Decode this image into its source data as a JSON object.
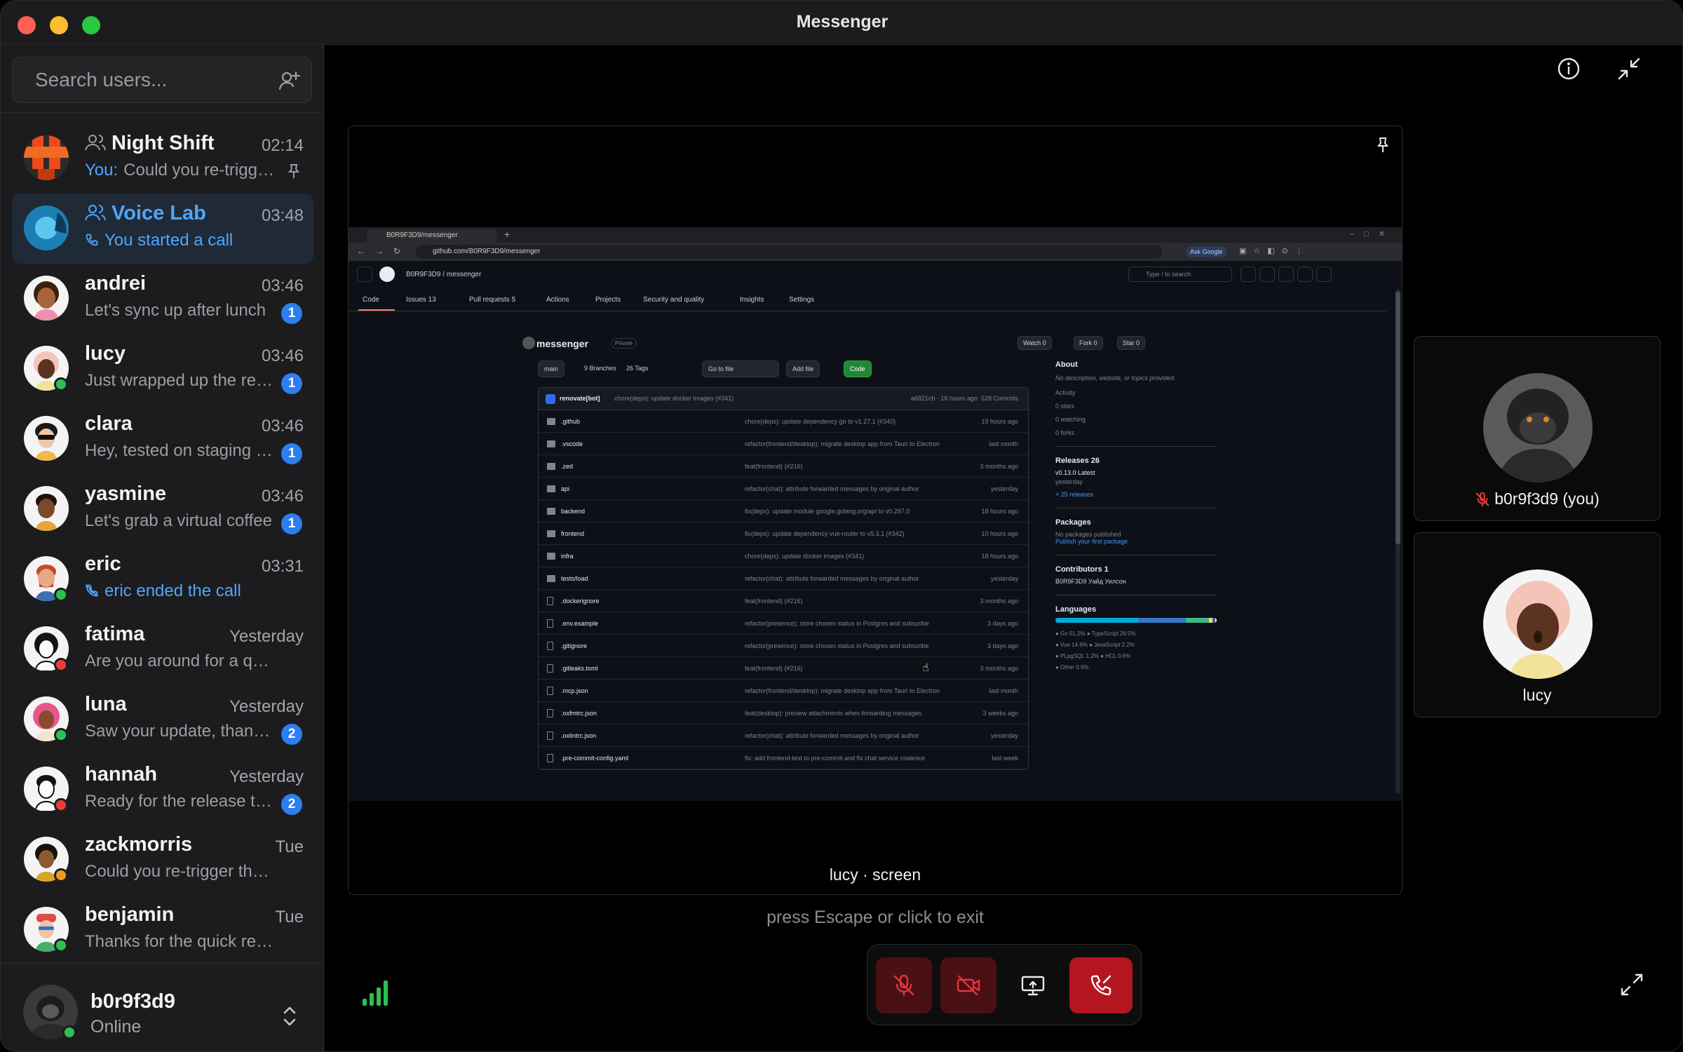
{
  "app": {
    "title": "Messenger"
  },
  "search": {
    "placeholder": "Search users..."
  },
  "conversations": [
    {
      "name": "Night Shift",
      "time": "02:14",
      "you": "You:",
      "preview": "Could you re-trigger the pipeline?",
      "group": true,
      "pinned": true,
      "status": null
    },
    {
      "name": "Voice Lab",
      "time": "03:48",
      "preview": "You started a call",
      "group": true,
      "call": true,
      "active": true,
      "status": null
    },
    {
      "name": "andrei",
      "time": "03:46",
      "preview": "Let's sync up after lunch",
      "badge": "1",
      "status": null
    },
    {
      "name": "lucy",
      "time": "03:46",
      "preview": "Just wrapped up the review",
      "badge": "1",
      "status": "online"
    },
    {
      "name": "clara",
      "time": "03:46",
      "preview": "Hey, tested on staging today",
      "badge": "1",
      "status": null
    },
    {
      "name": "yasmine",
      "time": "03:46",
      "preview": "Let's grab a virtual coffee",
      "badge": "1",
      "status": null
    },
    {
      "name": "eric",
      "time": "03:31",
      "preview": "eric ended the call",
      "call": true,
      "status": "online"
    },
    {
      "name": "fatima",
      "time": "Yesterday",
      "preview": "Are you around for a quick chat?",
      "status": "busy"
    },
    {
      "name": "luna",
      "time": "Yesterday",
      "preview": "Saw your update, thanks!",
      "badge": "2",
      "status": "online"
    },
    {
      "name": "hannah",
      "time": "Yesterday",
      "preview": "Ready for the release tomorrow?",
      "badge": "2",
      "status": "busy"
    },
    {
      "name": "zackmorris",
      "time": "Tue",
      "preview": "Could you re-trigger the build?",
      "status": "away"
    },
    {
      "name": "benjamin",
      "time": "Tue",
      "preview": "Thanks for the quick review!",
      "status": "online"
    }
  ],
  "self": {
    "name": "b0r9f3d9",
    "status": "Online"
  },
  "stage": {
    "label": "lucy · screen",
    "hint": "press Escape or click to exit"
  },
  "participants": [
    {
      "label": "b0r9f3d9 (you)",
      "muted": true
    },
    {
      "label": "lucy",
      "muted": false
    }
  ],
  "browser": {
    "tab_title": "B0R9F3D9/messenger",
    "url": "github.com/B0R9F3D9/messenger",
    "ask": "Ask Google"
  },
  "github": {
    "owner": "B0R9F3D9  /  messenger",
    "search": "Type / to search",
    "tabs": [
      "Code",
      "Issues 13",
      "Pull requests 5",
      "Actions",
      "Projects",
      "Security and quality",
      "Insights",
      "Settings"
    ],
    "repo": "messenger",
    "visibility": "Private",
    "watch": "Watch 0",
    "fork": "Fork 0",
    "star": "Star 0",
    "branch": "main",
    "branches": "9 Branches",
    "tags": "26 Tags",
    "goto": "Go to file",
    "add_file": "Add file",
    "code": "Code",
    "commit": {
      "author": "renovate[bot]",
      "message": "chore(deps): update docker images (#341)",
      "meta": "a6821cb · 18 hours ago",
      "commits": "528 Commits"
    },
    "files": [
      {
        "name": ".github",
        "dir": true,
        "msg": "chore(deps): update dependency go to v1.27.1 (#340)",
        "date": "19 hours ago"
      },
      {
        "name": ".vscode",
        "dir": true,
        "msg": "refactor(frontend/desktop): migrate desktop app from Tauri to Electron",
        "date": "last month"
      },
      {
        "name": ".zed",
        "dir": true,
        "msg": "feat(frontend) (#216)",
        "date": "3 months ago"
      },
      {
        "name": "api",
        "dir": true,
        "msg": "refactor(chat): attribute forwarded messages by original author",
        "date": "yesterday"
      },
      {
        "name": "backend",
        "dir": true,
        "msg": "fix(deps): update module google.golang.org/api to v0.297.0",
        "date": "18 hours ago"
      },
      {
        "name": "frontend",
        "dir": true,
        "msg": "fix(deps): update dependency vue-router to v5.3.1 (#342)",
        "date": "10 hours ago"
      },
      {
        "name": "infra",
        "dir": true,
        "msg": "chore(deps): update docker images (#341)",
        "date": "18 hours ago"
      },
      {
        "name": "tests/load",
        "dir": true,
        "msg": "refactor(chat): attribute forwarded messages by original author",
        "date": "yesterday"
      },
      {
        "name": ".dockerignore",
        "dir": false,
        "msg": "feat(frontend) (#216)",
        "date": "3 months ago"
      },
      {
        "name": ".env.example",
        "dir": false,
        "msg": "refactor(presence): store chosen status in Postgres and subscribe",
        "date": "3 days ago"
      },
      {
        "name": ".gitignore",
        "dir": false,
        "msg": "refactor(presence): store chosen status in Postgres and subscribe",
        "date": "3 days ago"
      },
      {
        "name": ".gitleaks.toml",
        "dir": false,
        "msg": "feat(frontend) (#216)",
        "date": "3 months ago"
      },
      {
        "name": ".mcp.json",
        "dir": false,
        "msg": "refactor(frontend/desktop): migrate desktop app from Tauri to Electron",
        "date": "last month"
      },
      {
        "name": ".oxfmtrc.json",
        "dir": false,
        "msg": "feat(desktop): preview attachments when forwarding messages",
        "date": "3 weeks ago"
      },
      {
        "name": ".oxlintrc.json",
        "dir": false,
        "msg": "refactor(chat): attribute forwarded messages by original author",
        "date": "yesterday"
      },
      {
        "name": ".pre-commit-config.yaml",
        "dir": false,
        "msg": "fix: add frontend-test to pre-commit and fix chat service coalesce",
        "date": "last week"
      }
    ],
    "about": {
      "title": "About",
      "desc": "No description, website, or topics provided.",
      "items": [
        "Activity",
        "0 stars",
        "0 watching",
        "0 forks"
      ],
      "releases_title": "Releases  26",
      "release": "v0.13.0  Latest",
      "release_date": "yesterday",
      "more_releases": "+ 25 releases",
      "packages_title": "Packages",
      "packages_desc": "No packages published",
      "packages_link": "Publish your first package",
      "contributors_title": "Contributors  1",
      "contributor": "B0R9F3D9  Уайд Уилсон",
      "languages_title": "Languages",
      "languages": [
        "● Go 51.2%    ● TypeScript 29.5%",
        "● Vue 14.6%    ● JavaScript 2.2%",
        "● PLpgSQL 1.2%    ● HCL 0.6%",
        "● Other 0.6%"
      ]
    }
  },
  "colors": {
    "accent": "#4ea6ff",
    "danger": "#b4161f",
    "online": "#2bc152"
  }
}
